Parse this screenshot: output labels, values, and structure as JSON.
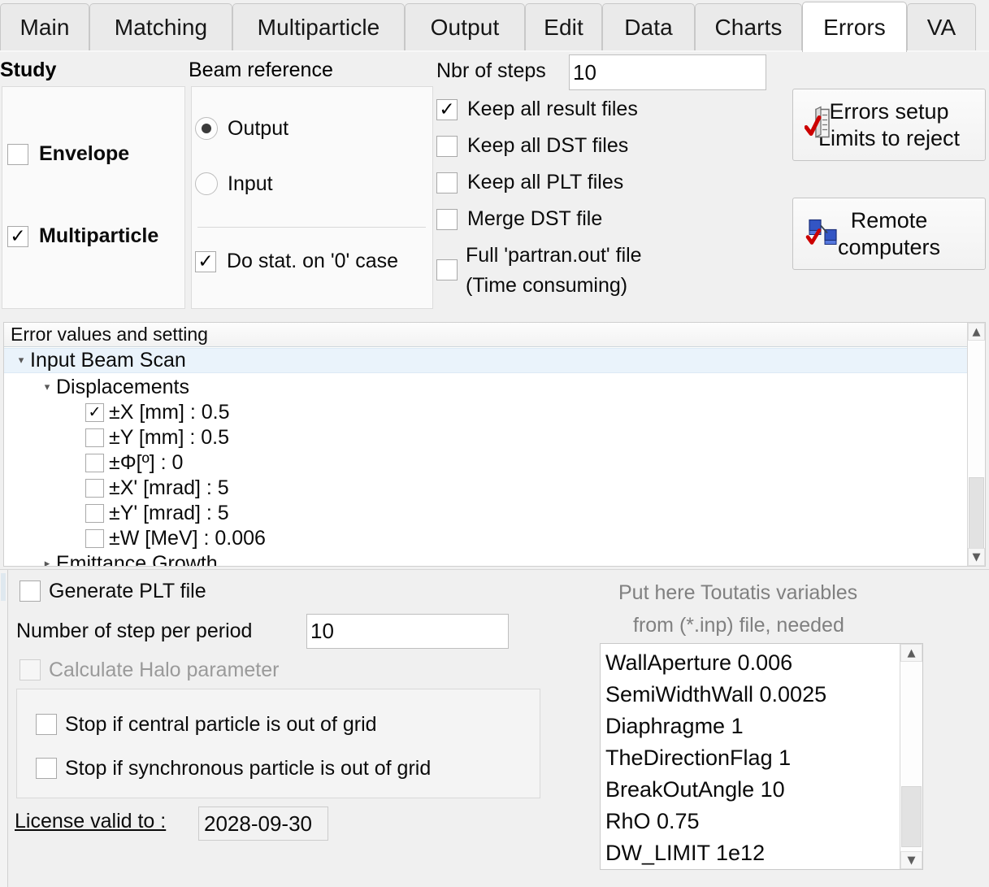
{
  "tabs": [
    {
      "label": "Main",
      "active": false
    },
    {
      "label": "Matching",
      "active": false
    },
    {
      "label": "Multiparticle",
      "active": false
    },
    {
      "label": "Output",
      "active": false
    },
    {
      "label": "Edit",
      "active": false
    },
    {
      "label": "Data",
      "active": false
    },
    {
      "label": "Charts",
      "active": false
    },
    {
      "label": "Errors",
      "active": true
    },
    {
      "label": "VA",
      "active": false
    }
  ],
  "study": {
    "title": "Study",
    "envelope": {
      "label": "Envelope",
      "checked": false,
      "mark": ""
    },
    "multiparticle": {
      "label": "Multiparticle",
      "checked": true,
      "mark": "✓"
    }
  },
  "beam_reference": {
    "title": "Beam reference",
    "output": {
      "label": "Output",
      "selected": true
    },
    "input": {
      "label": "Input",
      "selected": false
    },
    "do_stat": {
      "label": "Do stat. on '0' case",
      "checked": true,
      "mark": "✓"
    }
  },
  "steps": {
    "label": "Nbr of steps",
    "value": "10"
  },
  "options": [
    {
      "label": "Keep all result files",
      "checked": true,
      "mark": "✓"
    },
    {
      "label": "Keep all DST files",
      "checked": false,
      "mark": ""
    },
    {
      "label": "Keep all PLT files",
      "checked": false,
      "mark": ""
    },
    {
      "label": "Merge DST file",
      "checked": false,
      "mark": ""
    }
  ],
  "partran": {
    "line1": "Full 'partran.out' file",
    "line2": "(Time consuming)",
    "checked": false,
    "mark": ""
  },
  "buttons": {
    "errors_setup": {
      "line1": "Errors setup",
      "line2": "Limits to reject",
      "icon": "errors-setup-icon"
    },
    "remote_computers": {
      "line1": "Remote",
      "line2": "computers",
      "icon": "remote-computers-icon"
    }
  },
  "tree": {
    "header": "Error values and setting",
    "rows": [
      {
        "label": "Input Beam Scan",
        "indent": 0,
        "expander": "▾",
        "checkbox": false,
        "checked": false,
        "mark": "",
        "selected": true
      },
      {
        "label": "Displacements",
        "indent": 1,
        "expander": "▾",
        "checkbox": false,
        "checked": false,
        "mark": "",
        "selected": false
      },
      {
        "label": "±X [mm] : 0.5",
        "indent": 2,
        "expander": "",
        "checkbox": true,
        "checked": true,
        "mark": "✓",
        "selected": false
      },
      {
        "label": "±Y [mm] : 0.5",
        "indent": 2,
        "expander": "",
        "checkbox": true,
        "checked": false,
        "mark": "",
        "selected": false
      },
      {
        "label": "±Φ[º] : 0",
        "indent": 2,
        "expander": "",
        "checkbox": true,
        "checked": false,
        "mark": "",
        "selected": false
      },
      {
        "label": "±X' [mrad] : 5",
        "indent": 2,
        "expander": "",
        "checkbox": true,
        "checked": false,
        "mark": "",
        "selected": false
      },
      {
        "label": "±Y' [mrad] : 5",
        "indent": 2,
        "expander": "",
        "checkbox": true,
        "checked": false,
        "mark": "",
        "selected": false
      },
      {
        "label": "±W [MeV] : 0.006",
        "indent": 2,
        "expander": "",
        "checkbox": true,
        "checked": false,
        "mark": "",
        "selected": false
      },
      {
        "label": "Emittance Growth",
        "indent": 1,
        "expander": "▸",
        "checkbox": false,
        "checked": false,
        "mark": "",
        "selected": false
      }
    ],
    "scroll_up": "▲",
    "scroll_down": "▼"
  },
  "bottom": {
    "generate_plt": {
      "label": "Generate PLT file",
      "checked": false,
      "mark": ""
    },
    "steps_per_period": {
      "label": "Number of step per period",
      "value": "10"
    },
    "calculate_halo": {
      "label": "Calculate Halo parameter",
      "checked": false,
      "mark": "",
      "disabled": true
    },
    "stop_central": {
      "label": "Stop if central particle is out of grid",
      "checked": false,
      "mark": ""
    },
    "stop_synchronous": {
      "label": "Stop if synchronous particle is out of grid",
      "checked": false,
      "mark": ""
    },
    "license": {
      "label": "License valid to :",
      "value": "2028-09-30"
    }
  },
  "toutatis": {
    "hint_line1": "Put here Toutatis variables",
    "hint_line2": "from (*.inp) file, needed",
    "lines": [
      "WallAperture 0.006",
      "SemiWidthWall 0.0025",
      "Diaphragme 1",
      "TheDirectionFlag 1",
      "BreakOutAngle 10",
      "RhO 0.75",
      "DW_LIMIT 1e12"
    ],
    "scroll_up": "▲",
    "scroll_down": "▼"
  },
  "colors": {
    "page_bg": "#f0f0f0",
    "selection": "#eaf3fb",
    "accent_red": "#cc0000",
    "accent_blue": "#2b55c4",
    "muted_text": "#808080"
  }
}
